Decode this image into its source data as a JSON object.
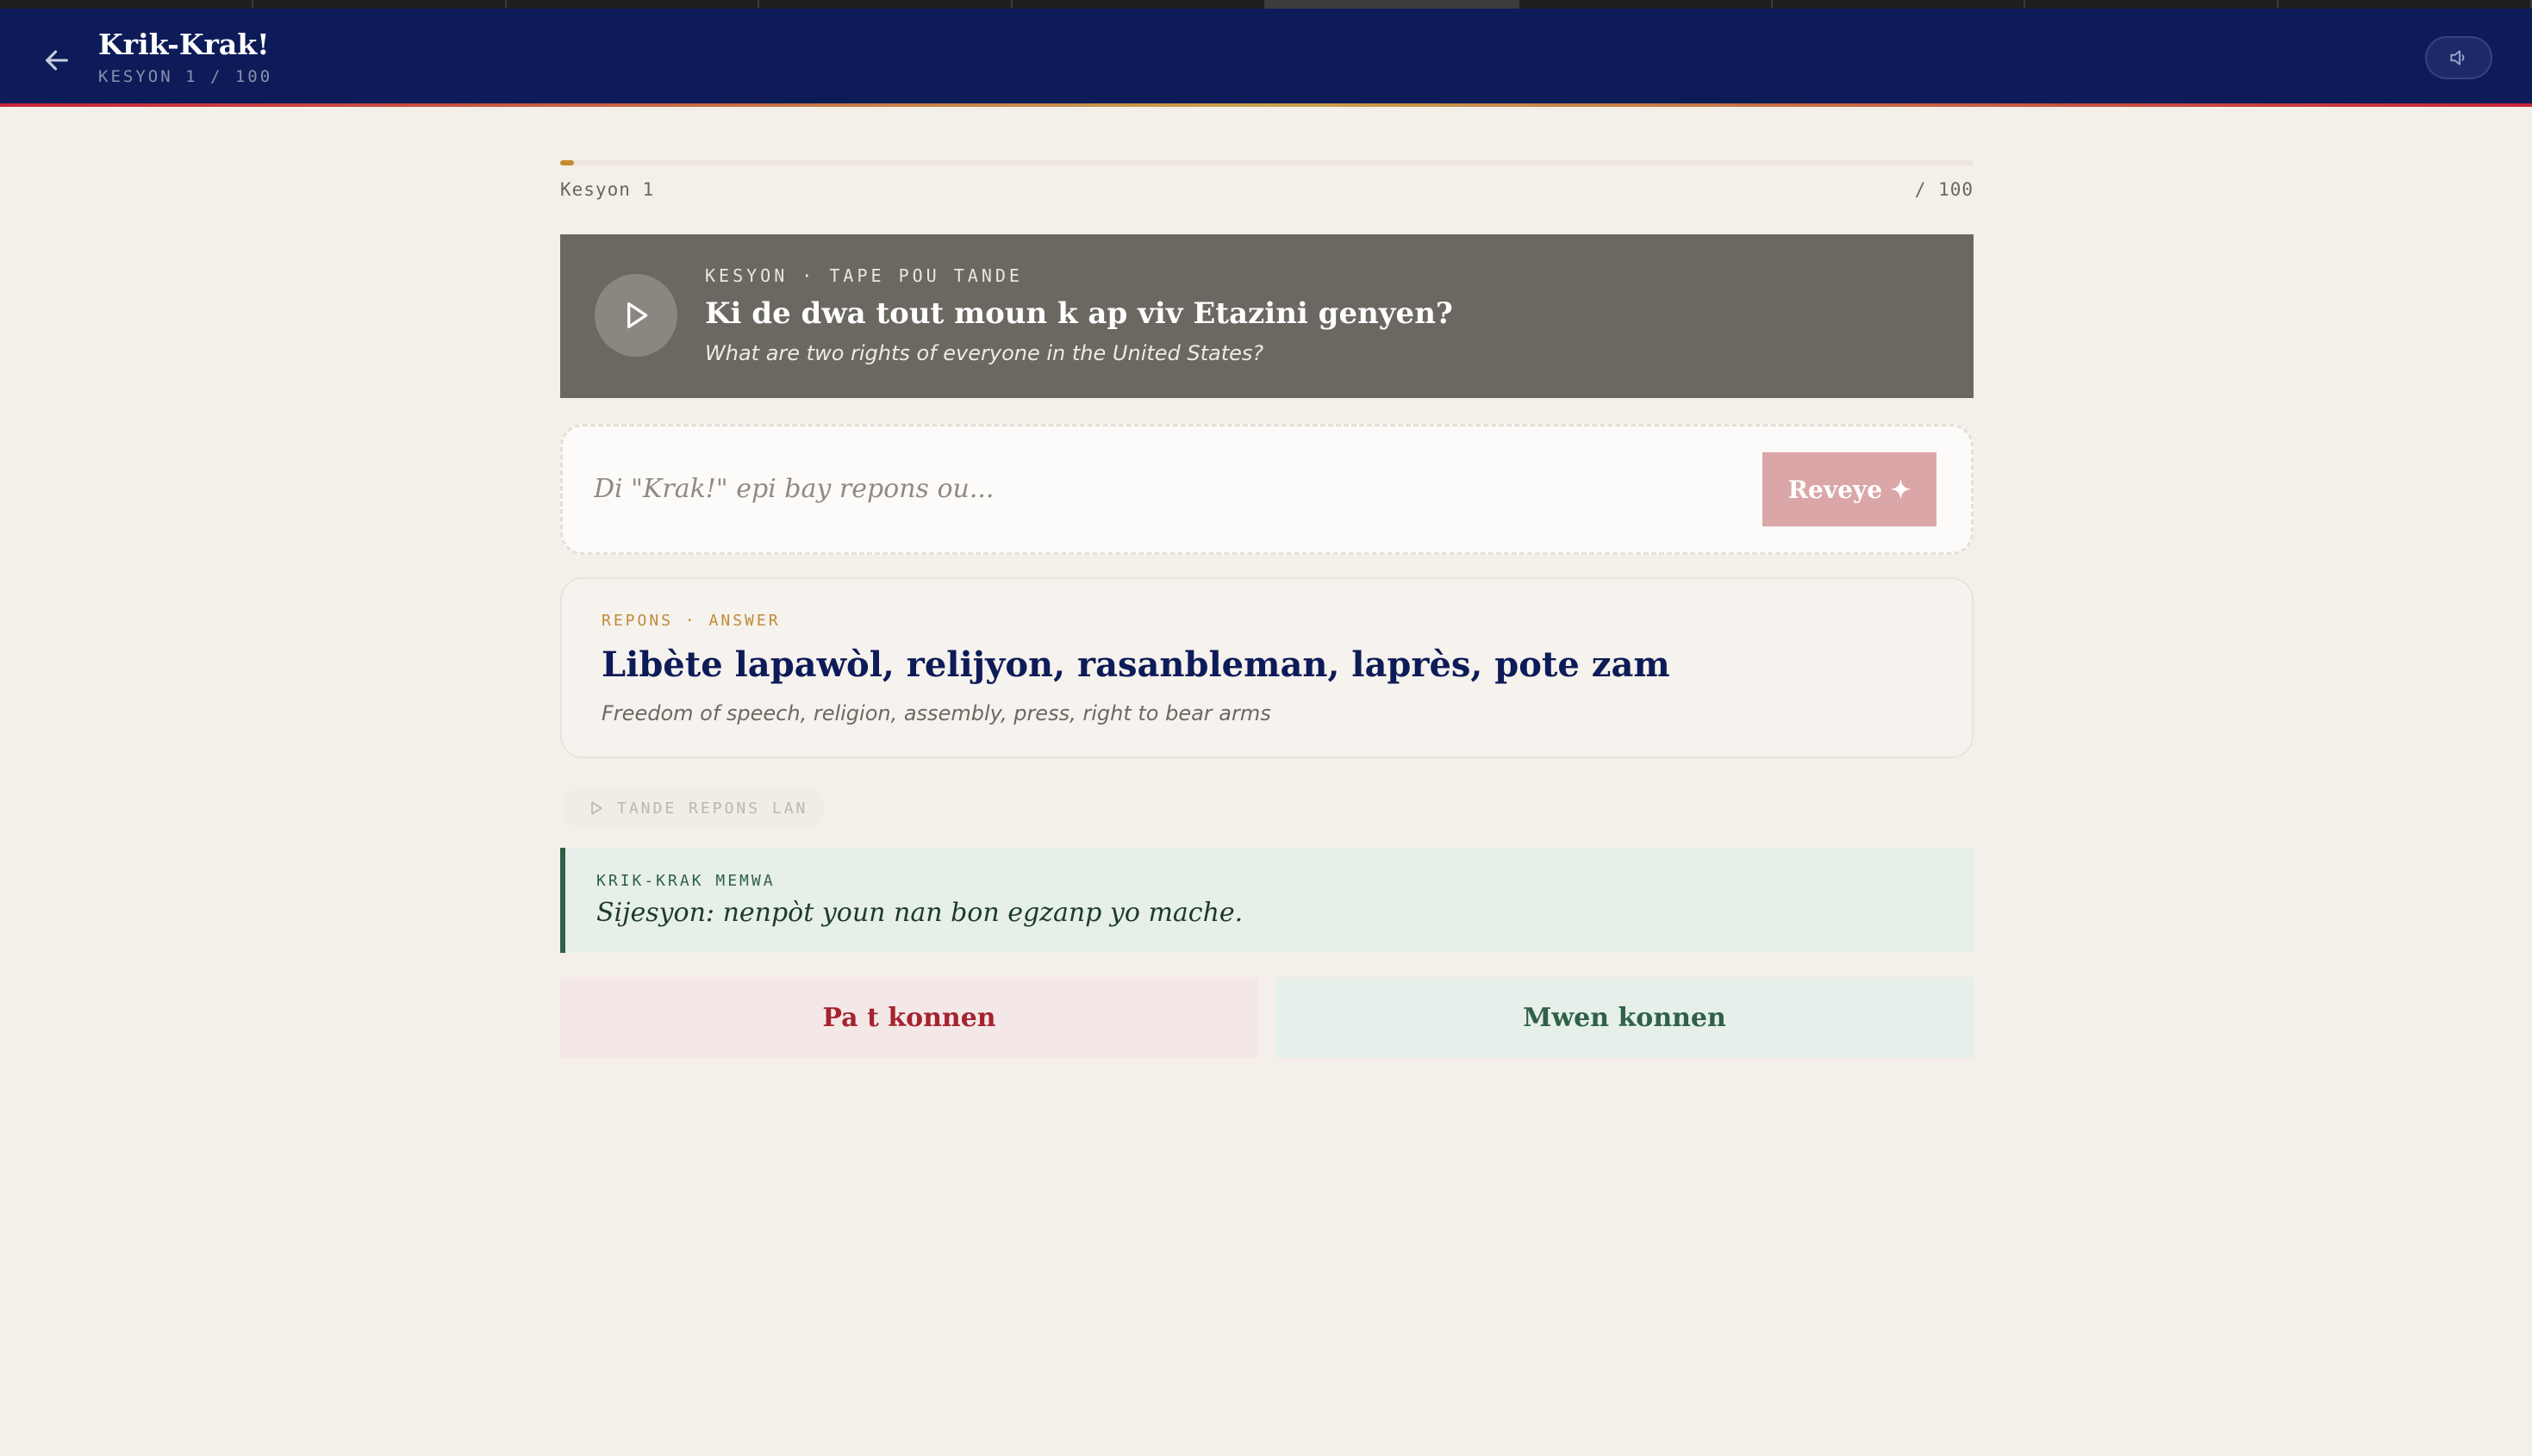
{
  "header": {
    "title": "Krik-Krak!",
    "subtitle": "KESYON 1 / 100"
  },
  "progress": {
    "current_label": "Kesyon 1",
    "total_label": "/ 100",
    "current": 1,
    "total": 100
  },
  "question": {
    "kicker": "KESYON · TAPE POU TANDE",
    "text": "Ki de dwa tout moun k ap viv Etazini genyen?",
    "translation": "What are two rights of everyone in the United States?"
  },
  "answer_input": {
    "placeholder": "Di \"Krak!\" epi bay repons ou...",
    "value": ""
  },
  "reveal_button": {
    "label": "Reveye ✦"
  },
  "repons": {
    "kicker": "REPONS · ANSWER",
    "text": "Libète lapawòl, relijyon, rasanbleman, laprès, pote zam",
    "translation": "Freedom of speech, religion, assembly, press, right to bear arms"
  },
  "listen_button": {
    "label": "TANDE REPONS LAN"
  },
  "memwa": {
    "kicker": "KRIK-KRAK MEMWA",
    "text": "Sijesyon: nenpòt youn nan bon egzanp yo mache."
  },
  "actions": {
    "dont_know": "Pa t konnen",
    "know": "Mwen konnen"
  },
  "icons": {
    "back": "arrow-left-icon",
    "sound": "speaker-icon",
    "play": "play-icon",
    "listen": "play-outline-icon",
    "sparkle": "sparkle-icon"
  },
  "colors": {
    "header_bg": "#0d1b58",
    "accent_gold": "#c88a2e",
    "reveal_bg": "#dba6a8",
    "dont_know_text": "#a5232f",
    "know_text": "#2f6146"
  }
}
